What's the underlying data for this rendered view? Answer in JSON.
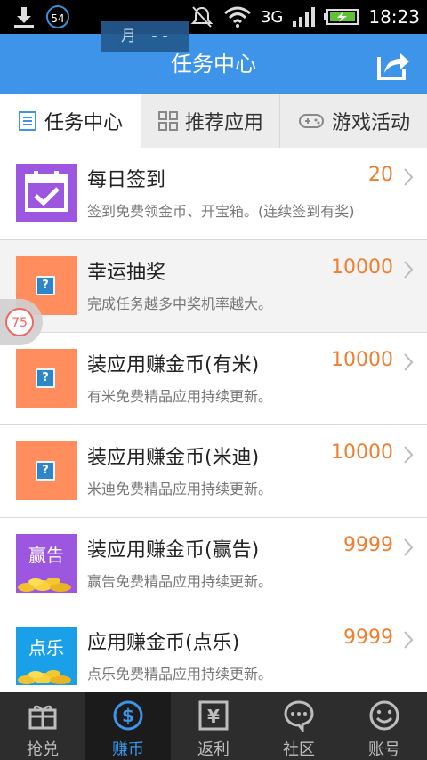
{
  "status_bar": {
    "badge_number": "54",
    "network": "3G",
    "time": "18:23"
  },
  "month_overlay": "月 --",
  "header": {
    "title": "任务中心"
  },
  "tabs": [
    {
      "label": "任务中心",
      "icon": "list-icon",
      "active": true
    },
    {
      "label": "推荐应用",
      "icon": "grid-icon",
      "active": false
    },
    {
      "label": "游戏活动",
      "icon": "gamepad-icon",
      "active": false
    }
  ],
  "tasks": [
    {
      "name": "每日签到",
      "desc": "签到免费领金币、开宝箱。(连续签到有奖)",
      "value": "20",
      "icon": "calendar-check-icon"
    },
    {
      "name": "幸运抽奖",
      "desc": "完成任务越多中奖机率越大。",
      "value": "10000",
      "icon": "placeholder-image-icon"
    },
    {
      "name": "装应用赚金币(有米)",
      "desc": "有米免费精品应用持续更新。",
      "value": "10000",
      "icon": "placeholder-image-icon"
    },
    {
      "name": "装应用赚金币(米迪)",
      "desc": "米迪免费精品应用持续更新。",
      "value": "10000",
      "icon": "placeholder-image-icon"
    },
    {
      "name": "装应用赚金币(赢告)",
      "desc": "赢告免费精品应用持续更新。",
      "value": "9999",
      "icon": "yinggao-logo",
      "logo_text": "赢告"
    },
    {
      "name": "应用赚金币(点乐)",
      "desc": "点乐免费精品应用持续更新。",
      "value": "9999",
      "icon": "dianle-logo",
      "logo_text": "点乐"
    }
  ],
  "floating_badge": "75",
  "bottom_nav": [
    {
      "label": "抢兑",
      "icon": "gift-icon",
      "active": false
    },
    {
      "label": "赚币",
      "icon": "dollar-coin-icon",
      "active": true
    },
    {
      "label": "返利",
      "icon": "yen-icon",
      "active": false
    },
    {
      "label": "社区",
      "icon": "chat-bubble-icon",
      "active": false
    },
    {
      "label": "账号",
      "icon": "smiley-icon",
      "active": false
    }
  ],
  "colors": {
    "header_blue": "#3d94e8",
    "value_orange": "#ef7e2e",
    "bottom_bar": "#2d2d2d",
    "active_tab_blue": "#3d94e8"
  }
}
